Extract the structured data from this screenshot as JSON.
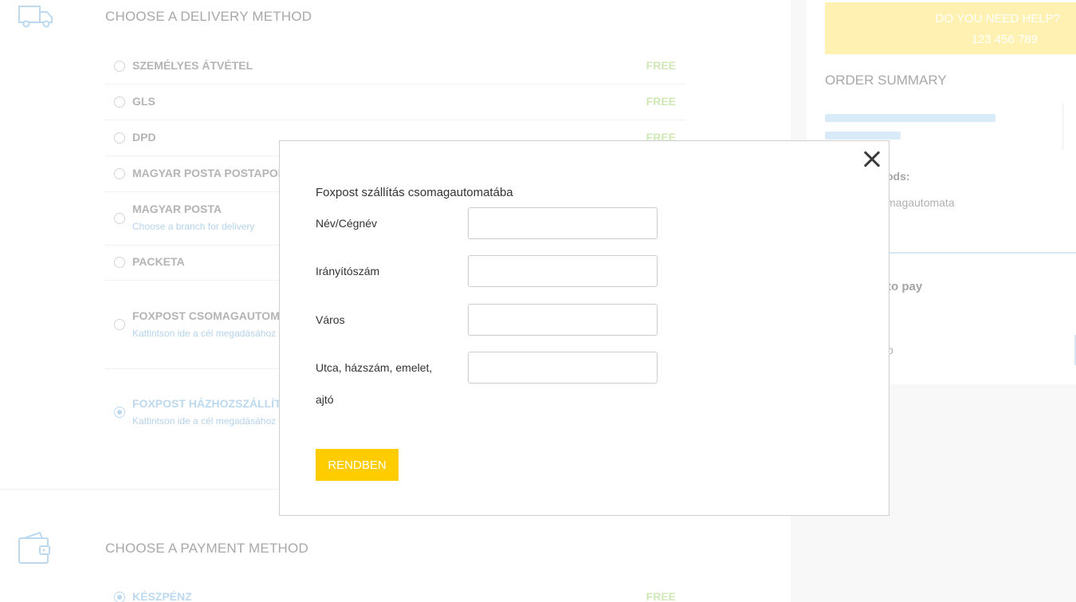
{
  "delivery": {
    "title": "CHOOSE A DELIVERY METHOD",
    "options": [
      {
        "name": "SZEMÉLYES ÁTVÉTEL",
        "price": "FREE"
      },
      {
        "name": "GLS",
        "price": "FREE"
      },
      {
        "name": "DPD",
        "price": "FREE"
      },
      {
        "name": "MAGYAR POSTA POSTAPONT",
        "price": ""
      },
      {
        "name": "MAGYAR POSTA",
        "sub": "Choose a branch for delivery",
        "price": ""
      },
      {
        "name": "PACKETA",
        "price": ""
      },
      {
        "name": "FOXPOST CSOMAGAUTOMAT",
        "sub": "Kattintson ide a cél megadásához",
        "price": ""
      },
      {
        "name": "FOXPOST HÁZHOZSZÁLLÍTÁ",
        "sub": "Kattintson ide a cél megadásához",
        "price": "",
        "selected": true
      }
    ]
  },
  "payment": {
    "title": "CHOOSE A PAYMENT METHOD",
    "options": [
      {
        "name": "KÉSZPÉNZ",
        "price": "FREE",
        "selected": true
      }
    ]
  },
  "aside": {
    "help_line1": "DO YOU NEED HELP?",
    "help_line2": "123 456 789",
    "order_summary": "ORDER SUMMARY",
    "partial_goods": "ods:",
    "partial_automata": "magautomata",
    "partial_to_pay": "to pay",
    "partial_p": "p"
  },
  "modal": {
    "title": "Foxpost szállítás csomagautomatába",
    "fields": [
      {
        "label": "Név/Cégnév",
        "value": ""
      },
      {
        "label": "Irányítószám",
        "value": ""
      },
      {
        "label": "Város",
        "value": ""
      },
      {
        "label": "Utca, házszám, emelet,",
        "label2": "ajtó",
        "value": ""
      }
    ],
    "ok_label": "RENDBEN"
  },
  "colors": {
    "accent_yellow": "#ffcc00",
    "help_bg": "#fff1b1",
    "free_green": "#cfe8b6",
    "link_blue": "#b6d3ea"
  }
}
